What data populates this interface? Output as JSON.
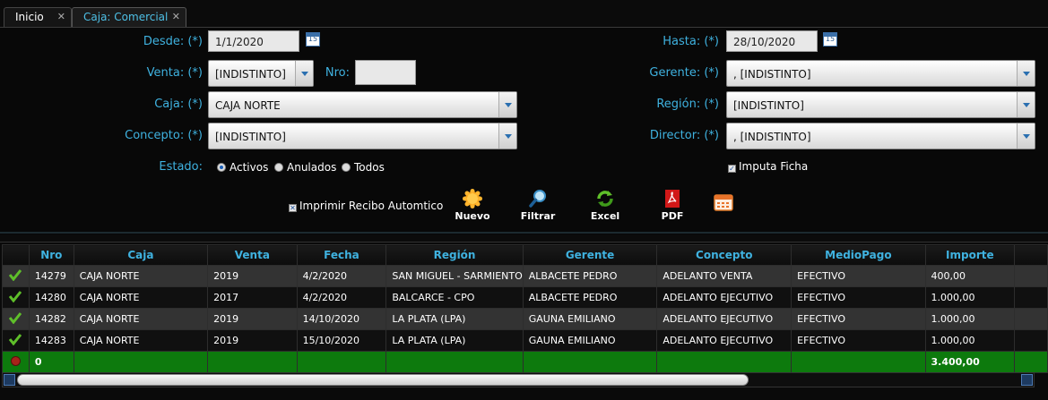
{
  "tabs": [
    {
      "label": "Inicio",
      "close": "✕"
    },
    {
      "label": "Caja: Comercial",
      "close": "✕"
    }
  ],
  "form": {
    "desde_label": "Desde: (*)",
    "desde_value": "1/1/2020",
    "hasta_label": "Hasta: (*)",
    "hasta_value": "28/10/2020",
    "calendar_text": "15",
    "venta_label": "Venta: (*)",
    "venta_value": "[INDISTINTO]",
    "nro_label": "Nro:",
    "nro_value": "",
    "gerente_label": "Gerente: (*)",
    "gerente_value": ", [INDISTINTO]",
    "caja_label": "Caja: (*)",
    "caja_value": "CAJA NORTE",
    "region_label": "Región: (*)",
    "region_value": "[INDISTINTO]",
    "concepto_label": "Concepto: (*)",
    "concepto_value": "[INDISTINTO]",
    "director_label": "Director: (*)",
    "director_value": ", [INDISTINTO]",
    "estado_label": "Estado:",
    "estado_options": [
      "Activos",
      "Anulados",
      "Todos"
    ],
    "estado_selected": "Activos",
    "imputa_ficha": "Imputa Ficha",
    "imprimir_recibo": "Imprimir Recibo Automtico"
  },
  "toolbar": {
    "nuevo": "Nuevo",
    "filtrar": "Filtrar",
    "excel": "Excel",
    "pdf": "PDF"
  },
  "table": {
    "columns": [
      "Nro",
      "Caja",
      "Venta",
      "Fecha",
      "Región",
      "Gerente",
      "Concepto",
      "MedioPago",
      "Importe"
    ],
    "rows": [
      [
        "14279",
        "CAJA NORTE",
        "2019",
        "4/2/2020",
        "SAN MIGUEL - SARMIENTO",
        "ALBACETE PEDRO",
        "ADELANTO VENTA",
        "EFECTIVO",
        "400,00"
      ],
      [
        "14280",
        "CAJA NORTE",
        "2017",
        "4/2/2020",
        "BALCARCE - CPO",
        "ALBACETE PEDRO",
        "ADELANTO EJECUTIVO",
        "EFECTIVO",
        "1.000,00"
      ],
      [
        "14282",
        "CAJA NORTE",
        "2019",
        "14/10/2020",
        "LA PLATA (LPA)",
        "GAUNA  EMILIANO",
        "ADELANTO EJECUTIVO",
        "EFECTIVO",
        "1.000,00"
      ],
      [
        "14283",
        "CAJA NORTE",
        "2019",
        "15/10/2020",
        "LA PLATA (LPA)",
        "GAUNA  EMILIANO",
        "ADELANTO EJECUTIVO",
        "EFECTIVO",
        "1.000,00"
      ]
    ],
    "total": {
      "nro": "0",
      "importe": "3.400,00"
    }
  },
  "colors": {
    "accent": "#3fb2e0",
    "total_row": "#0d7a0d",
    "check": "#5fbf2a"
  }
}
